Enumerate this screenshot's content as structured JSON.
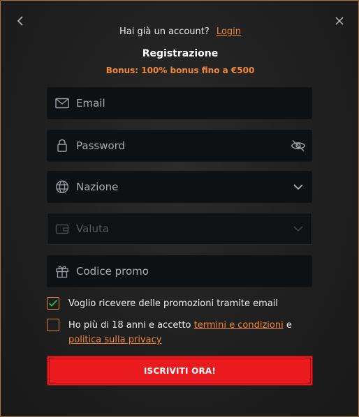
{
  "header": {
    "have_account_text": "Hai già un account?",
    "login_link": "Login",
    "title": "Registrazione",
    "bonus": "Bonus: 100% bonus fino a €500"
  },
  "form": {
    "email": {
      "placeholder": "Email",
      "value": "",
      "icon": "mail-icon"
    },
    "password": {
      "placeholder": "Password",
      "value": "",
      "icon": "lock-icon",
      "trailing_icon": "eye-off-icon"
    },
    "country": {
      "placeholder": "Nazione",
      "value": "",
      "icon": "globe-icon",
      "trailing_icon": "chevron-down-icon"
    },
    "currency": {
      "placeholder": "Valuta",
      "value": "",
      "icon": "wallet-icon",
      "trailing_icon": "chevron-down-icon",
      "disabled": true
    },
    "promo": {
      "placeholder": "Codice promo",
      "value": "",
      "icon": "gift-icon"
    }
  },
  "checks": {
    "promotions": {
      "label": "Voglio ricevere delle promozioni tramite email",
      "checked": true
    },
    "terms": {
      "label_prefix": "Ho più di 18 anni e accetto ",
      "terms_link": "termini e condizioni",
      "conjunction": " e ",
      "privacy_link": "politica sulla privacy",
      "checked": false
    }
  },
  "submit_label": "ISCRIVITI ORA!",
  "colors": {
    "accent": "#f0883a",
    "cta": "#ea1a1e",
    "border": "#b0763d",
    "field_bg": "#0e1114",
    "check_mark": "#35b54a"
  }
}
